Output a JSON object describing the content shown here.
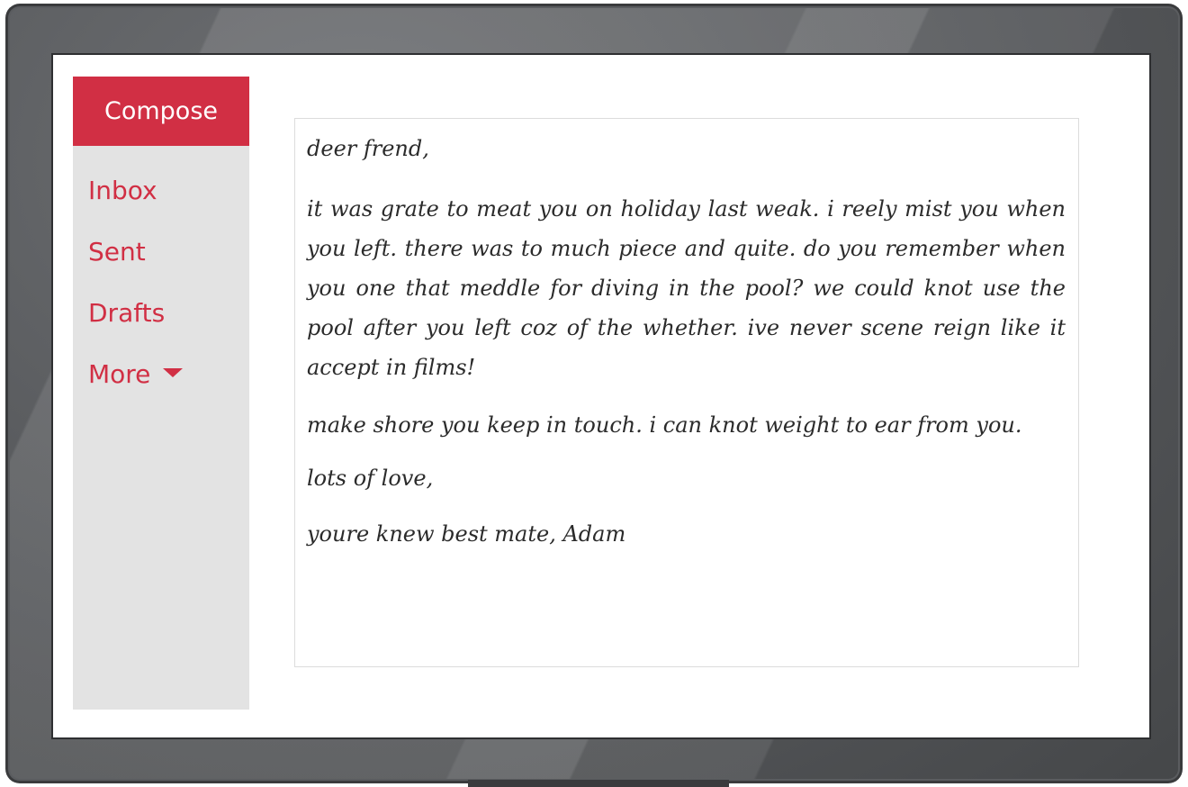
{
  "sidebar": {
    "compose_label": "Compose",
    "items": [
      {
        "label": "Inbox"
      },
      {
        "label": "Sent"
      },
      {
        "label": "Drafts"
      },
      {
        "label": "More"
      }
    ]
  },
  "message": {
    "greeting": "deer frend,",
    "paragraph1": "it was grate to meat you on holiday last weak. i reely mist you when you left. there was to much piece and quite. do you remember when you one that meddle for diving in the pool? we could knot use the pool after you left coz of the whether. ive never scene reign like it accept in films!",
    "paragraph2": "make shore you keep in touch. i can knot weight to ear from you.",
    "closing": "lots of love,",
    "signature": "youre knew best mate, Adam"
  },
  "colors": {
    "accent": "#d12f44",
    "sidebar_bg": "#e3e3e3",
    "bezel": "#55575a"
  }
}
